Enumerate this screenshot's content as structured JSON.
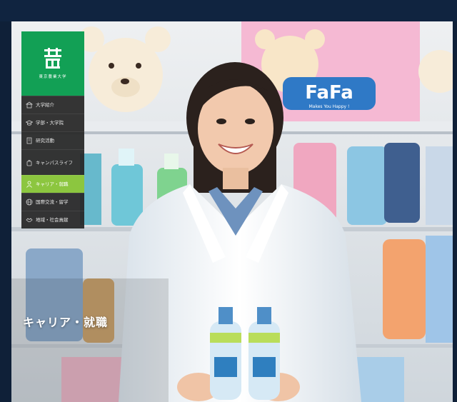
{
  "logo": {
    "mark": "農",
    "text": "東京農業大学"
  },
  "nav": {
    "items": [
      {
        "label": "大学紹介",
        "icon": "building-icon"
      },
      {
        "label": "学部・大学院",
        "icon": "graduation-cap-icon"
      },
      {
        "label": "研究活動",
        "icon": "book-icon"
      },
      {
        "label": "キャンパスライフ",
        "icon": "backpack-icon"
      },
      {
        "label": "キャリア・就職",
        "icon": "person-icon",
        "active": true
      },
      {
        "label": "国際交流・留学",
        "icon": "globe-icon"
      },
      {
        "label": "地域・社会貢献",
        "icon": "handshake-icon"
      }
    ]
  },
  "hero": {
    "heading": "キャリア・就職",
    "display_text": "FaFa",
    "display_subtext": "Makes You Happy !"
  },
  "colors": {
    "brand_green": "#12a055",
    "active_green": "#8cc63f",
    "nav_bg": "#262626",
    "frame_navy": "#0f2038"
  }
}
